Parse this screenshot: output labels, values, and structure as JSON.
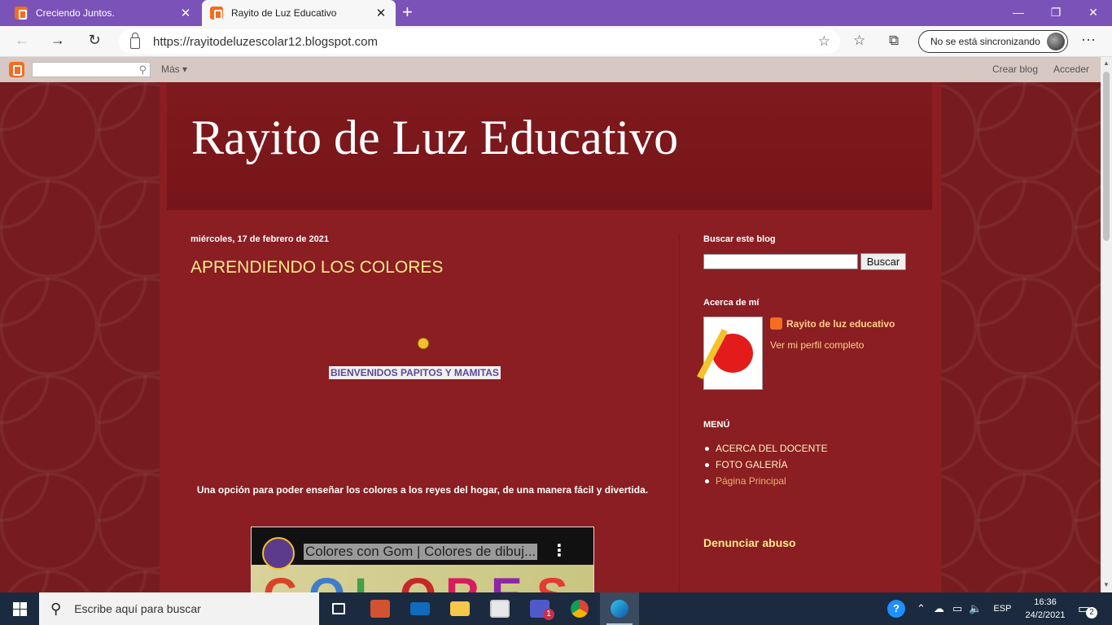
{
  "browser": {
    "tabs": [
      {
        "title": "Creciendo Juntos.",
        "close": "✕"
      },
      {
        "title": "Rayito de Luz Educativo",
        "close": "✕"
      }
    ],
    "new_tab": "+",
    "window_controls": [
      "—",
      "❐",
      "✕"
    ],
    "url": "https://rayitodeluzescolar12.blogspot.com",
    "sync_label": "No se está sincronizando",
    "more": "···"
  },
  "blogger_bar": {
    "more_label": "Más ▾",
    "create_blog": "Crear blog",
    "sign_in": "Acceder"
  },
  "blog": {
    "title": "Rayito de Luz Educativo"
  },
  "post": {
    "date": "miércoles, 17 de febrero de 2021",
    "title": "APRENDIENDO LOS COLORES",
    "welcome": "BIENVENIDOS PAPITOS Y MAMITAS",
    "description": "Una opción para poder enseñar los colores  a los reyes del hogar, de una manera fácil y divertida.",
    "video": {
      "title": "Colores con Gom | Colores de dibuj...",
      "art_letters": [
        "C",
        "O",
        "L",
        "O",
        "R",
        "E",
        "S"
      ],
      "art_colors": [
        "#d8432a",
        "#3f7cc9",
        "#43a047",
        "#c62828",
        "#d81b60",
        "#8e24aa",
        "#e53935"
      ]
    }
  },
  "sidebar": {
    "search_heading": "Buscar este blog",
    "search_button": "Buscar",
    "about_heading": "Acerca de mí",
    "profile_name": "Rayito de luz educativo",
    "profile_link": "Ver mi perfil completo",
    "menu_heading": "MENÚ",
    "menu_items": [
      "ACERCA DEL DOCENTE",
      "FOTO GALERÍA",
      "Página Principal"
    ],
    "report_abuse": "Denunciar abuso"
  },
  "taskbar": {
    "search_placeholder": "Escribe aquí para buscar",
    "language": "ESP",
    "time": "16:36",
    "date": "24/2/2021",
    "teams_badge": "1",
    "notifications_badge": "2"
  }
}
